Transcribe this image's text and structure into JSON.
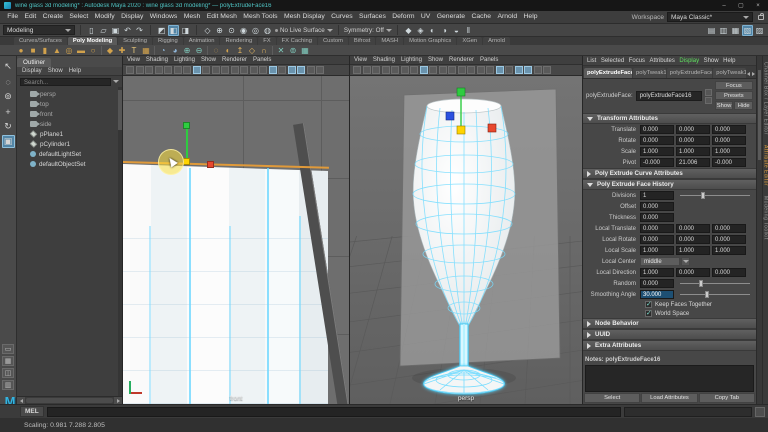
{
  "titlebar": {
    "title": "wine glass 3d modeling* : Autodesk Maya 2020 : wine glass 3d modeling*  —  polyExtrudeFace16",
    "minimize": "–",
    "maximize": "▢",
    "close": "×"
  },
  "menubar": {
    "items": [
      "File",
      "Edit",
      "Create",
      "Select",
      "Modify",
      "Display",
      "Windows",
      "Mesh",
      "Edit Mesh",
      "Mesh Tools",
      "Mesh Display",
      "Curves",
      "Surfaces",
      "Deform",
      "UV",
      "Generate",
      "Cache",
      "Arnold",
      "Help"
    ],
    "workspace_label": "Workspace",
    "workspace_value": "Maya Classic*"
  },
  "toolbar": {
    "mode": "Modeling",
    "file_icons": [
      {
        "name": "new-scene-icon",
        "glyph": "▯"
      },
      {
        "name": "open-scene-icon",
        "glyph": "▱"
      },
      {
        "name": "save-scene-icon",
        "glyph": "▣"
      },
      {
        "name": "undo-icon",
        "glyph": "↶"
      },
      {
        "name": "redo-icon",
        "glyph": "↷"
      }
    ],
    "mask_icons": [
      {
        "name": "select-hierarchy-icon",
        "glyph": "◩"
      },
      {
        "name": "select-object-icon",
        "glyph": "◧",
        "state": "active"
      },
      {
        "name": "select-component-icon",
        "glyph": "◨"
      }
    ],
    "snap_icons": [
      {
        "name": "snap-grid-icon",
        "glyph": "◇"
      },
      {
        "name": "snap-curve-icon",
        "glyph": "⊕"
      },
      {
        "name": "snap-point-icon",
        "glyph": "⊙"
      },
      {
        "name": "snap-projected-center-icon",
        "glyph": "◉"
      },
      {
        "name": "snap-view-plane-icon",
        "glyph": "◎"
      },
      {
        "name": "make-live-icon",
        "glyph": "◍"
      }
    ],
    "no_live_surface": "No Live Surface",
    "symmetry": "Symmetry: Off",
    "render_icons": [
      {
        "name": "render-current-frame-icon",
        "glyph": "◆"
      },
      {
        "name": "ipr-render-icon",
        "glyph": "◈"
      },
      {
        "name": "render-settings-icon",
        "glyph": "◐"
      },
      {
        "name": "hypershade-icon",
        "glyph": "◑"
      },
      {
        "name": "light-editor-icon",
        "glyph": "◒"
      },
      {
        "name": "pause-viewport-icon",
        "glyph": "‖"
      }
    ],
    "right_icons": [
      {
        "name": "modeling-toolkit-toggle-icon",
        "glyph": "▤"
      },
      {
        "name": "character-controls-toggle-icon",
        "glyph": "▥"
      },
      {
        "name": "channel-box-toggle-icon",
        "glyph": "▦"
      },
      {
        "name": "attribute-editor-toggle-icon",
        "glyph": "▧",
        "state": "active"
      },
      {
        "name": "tool-settings-toggle-icon",
        "glyph": "▨"
      }
    ]
  },
  "shelf": {
    "tabs": [
      {
        "label": "Curves/Surfaces"
      },
      {
        "label": "Poly Modeling",
        "state": "active"
      },
      {
        "label": "Sculpting"
      },
      {
        "label": "Rigging"
      },
      {
        "label": "Animation"
      },
      {
        "label": "Rendering"
      },
      {
        "label": "FX"
      },
      {
        "label": "FX Caching"
      },
      {
        "label": "Custom"
      },
      {
        "label": "Bifrost"
      },
      {
        "label": "MASH"
      },
      {
        "label": "Motion Graphics"
      },
      {
        "label": "XGen"
      },
      {
        "label": "Arnold"
      }
    ],
    "icons": [
      {
        "name": "poly-sphere-icon",
        "glyph": "●",
        "color": "#d2a24c"
      },
      {
        "name": "poly-cube-icon",
        "glyph": "■",
        "color": "#d2a24c"
      },
      {
        "name": "poly-cylinder-icon",
        "glyph": "▮",
        "color": "#d2a24c"
      },
      {
        "name": "poly-cone-icon",
        "glyph": "▲",
        "color": "#d2a24c"
      },
      {
        "name": "poly-torus-icon",
        "glyph": "◎",
        "color": "#d2a24c"
      },
      {
        "name": "poly-plane-icon",
        "glyph": "▬",
        "color": "#d2a24c"
      },
      {
        "name": "poly-disc-icon",
        "glyph": "○",
        "color": "#d2a24c"
      },
      {
        "name": "shelf-divider",
        "state": "divider",
        "glyph": ""
      },
      {
        "name": "platonic-solid-icon",
        "glyph": "◆",
        "color": "#d2a24c"
      },
      {
        "name": "sweep-mesh-icon",
        "glyph": "✚",
        "color": "#d2a24c"
      },
      {
        "name": "type-tool-icon",
        "glyph": "T",
        "color": "#e8c87a"
      },
      {
        "name": "svg-tool-icon",
        "glyph": "▦",
        "color": "#d2a24c"
      },
      {
        "name": "shelf-divider",
        "state": "divider",
        "glyph": ""
      },
      {
        "name": "booleans-union-icon",
        "glyph": "◔",
        "color": "#8fb6d9"
      },
      {
        "name": "booleans-difference-icon",
        "glyph": "◕",
        "color": "#8fb6d9"
      },
      {
        "name": "combine-icon",
        "glyph": "⊕",
        "color": "#7fcabc"
      },
      {
        "name": "separate-icon",
        "glyph": "⊖",
        "color": "#7fcabc"
      },
      {
        "name": "shelf-divider",
        "state": "divider",
        "glyph": ""
      },
      {
        "name": "smooth-icon",
        "glyph": "◌",
        "color": "#d2a24c"
      },
      {
        "name": "mirror-icon",
        "glyph": "◐",
        "color": "#d2a24c"
      },
      {
        "name": "extrude-icon",
        "glyph": "↥",
        "color": "#e0b35f"
      },
      {
        "name": "bevel-icon",
        "glyph": "◇",
        "color": "#e0b35f"
      },
      {
        "name": "bridge-icon",
        "glyph": "∩",
        "color": "#e0b35f"
      },
      {
        "name": "shelf-divider",
        "state": "divider",
        "glyph": ""
      },
      {
        "name": "multi-cut-icon",
        "glyph": "✕",
        "color": "#7fcabc"
      },
      {
        "name": "target-weld-icon",
        "glyph": "⊚",
        "color": "#7fcabc"
      },
      {
        "name": "quad-draw-icon",
        "glyph": "▦",
        "color": "#7fcabc"
      }
    ]
  },
  "toolbox": {
    "tools": [
      {
        "name": "select-tool-icon",
        "glyph": "↖"
      },
      {
        "name": "lasso-select-tool-icon",
        "glyph": "◌"
      },
      {
        "name": "paint-select-tool-icon",
        "glyph": "⊚"
      },
      {
        "name": "move-tool-icon",
        "glyph": "+"
      },
      {
        "name": "rotate-tool-icon",
        "glyph": "↻"
      },
      {
        "name": "scale-tool-icon",
        "glyph": "▣",
        "state": "active"
      }
    ],
    "layouts": [
      {
        "name": "layout-single-pane-icon",
        "glyph": "▭"
      },
      {
        "name": "layout-four-pane-icon",
        "glyph": "▦"
      },
      {
        "name": "layout-two-pane-icon",
        "glyph": "◫"
      },
      {
        "name": "layout-outliner-pane-icon",
        "glyph": "▥"
      }
    ]
  },
  "outliner": {
    "tab": "Outliner",
    "menus": [
      "Display",
      "Show",
      "Help"
    ],
    "search_placeholder": "Search...",
    "items": [
      {
        "label": "persp",
        "type": "camera",
        "state": "dim"
      },
      {
        "label": "top",
        "type": "camera",
        "state": "dim"
      },
      {
        "label": "front",
        "type": "camera",
        "state": "dim"
      },
      {
        "label": "side",
        "type": "camera",
        "state": "dim"
      },
      {
        "label": "pPlane1",
        "type": "mesh"
      },
      {
        "label": "pCylinder1",
        "type": "mesh"
      },
      {
        "label": "defaultLightSet",
        "type": "set"
      },
      {
        "label": "defaultObjectSet",
        "type": "set"
      }
    ]
  },
  "viewport_menus": [
    "View",
    "Shading",
    "Lighting",
    "Show",
    "Renderer",
    "Panels"
  ],
  "viewport_left": {
    "camera_label": "front",
    "icons": [
      {
        "name": "vp-select-camera-icon"
      },
      {
        "name": "vp-lock-camera-icon"
      },
      {
        "name": "vp-camera-attrs-icon"
      },
      {
        "name": "vp-bookmark-icon"
      },
      {
        "name": "vp-image-plane-icon"
      },
      {
        "name": "vp-2d-pan-zoom-icon"
      },
      {
        "name": "vp-grease-pencil-icon"
      },
      {
        "name": "vp-grid-icon",
        "state": "active"
      },
      {
        "name": "vp-film-gate-icon"
      },
      {
        "name": "vp-resolution-gate-icon"
      },
      {
        "name": "vp-gate-mask-icon"
      },
      {
        "name": "vp-field-chart-icon"
      },
      {
        "name": "vp-safe-action-icon"
      },
      {
        "name": "vp-safe-title-icon"
      },
      {
        "name": "vp-wireframe-icon"
      },
      {
        "name": "vp-shaded-icon",
        "state": "active"
      },
      {
        "name": "vp-textured-icon"
      },
      {
        "name": "vp-use-all-lights-icon",
        "state": "active"
      },
      {
        "name": "vp-shadows-icon",
        "state": "active"
      },
      {
        "name": "vp-ao-icon"
      },
      {
        "name": "vp-anti-alias-icon"
      }
    ]
  },
  "viewport_right": {
    "camera_label": "persp",
    "icons": [
      {
        "name": "vp-select-camera-icon"
      },
      {
        "name": "vp-lock-camera-icon"
      },
      {
        "name": "vp-camera-attrs-icon"
      },
      {
        "name": "vp-bookmark-icon"
      },
      {
        "name": "vp-image-plane-icon"
      },
      {
        "name": "vp-2d-pan-zoom-icon"
      },
      {
        "name": "vp-grease-pencil-icon"
      },
      {
        "name": "vp-grid-icon",
        "state": "active"
      },
      {
        "name": "vp-film-gate-icon"
      },
      {
        "name": "vp-resolution-gate-icon"
      },
      {
        "name": "vp-gate-mask-icon"
      },
      {
        "name": "vp-field-chart-icon"
      },
      {
        "name": "vp-safe-action-icon"
      },
      {
        "name": "vp-safe-title-icon"
      },
      {
        "name": "vp-wireframe-icon"
      },
      {
        "name": "vp-shaded-icon",
        "state": "active"
      },
      {
        "name": "vp-textured-icon"
      },
      {
        "name": "vp-use-all-lights-icon",
        "state": "active"
      },
      {
        "name": "vp-shadows-icon",
        "state": "active"
      },
      {
        "name": "vp-ao-icon"
      },
      {
        "name": "vp-anti-alias-icon"
      }
    ]
  },
  "attribute_editor": {
    "menus": [
      {
        "label": "List"
      },
      {
        "label": "Selected"
      },
      {
        "label": "Focus"
      },
      {
        "label": "Attributes"
      },
      {
        "label": "Display",
        "state": "accent"
      },
      {
        "label": "Show"
      },
      {
        "label": "Help"
      }
    ],
    "tabs": [
      {
        "label": "polyExtrudeFace16",
        "state": "active"
      },
      {
        "label": "polyTweak15"
      },
      {
        "label": "polyExtrudeFace15"
      },
      {
        "label": "polyTweak14"
      }
    ],
    "node_label": "polyExtrudeFace:",
    "node_value": "polyExtrudeFace16",
    "focus_btn": "Focus",
    "presets_btn": "Presets",
    "show_btn": "Show",
    "hide_btn": "Hide",
    "transform": {
      "title": "Transform Attributes",
      "rows": [
        {
          "label": "Translate",
          "v1": "0.000",
          "v2": "0.000",
          "v3": "0.000"
        },
        {
          "label": "Rotate",
          "v1": "0.000",
          "v2": "0.000",
          "v3": "0.000"
        },
        {
          "label": "Scale",
          "v1": "1.000",
          "v2": "1.000",
          "v3": "1.000"
        },
        {
          "label": "Pivot",
          "v1": "-0.000",
          "v2": "21.006",
          "v3": "-0.000"
        }
      ]
    },
    "curve_section_title": "Poly Extrude Curve Attributes",
    "history": {
      "title": "Poly Extrude Face History",
      "divisions_label": "Divisions",
      "divisions_value": "1",
      "offset_label": "Offset",
      "offset_value": "0.000",
      "thickness_label": "Thickness",
      "thickness_value": "0.000",
      "local_translate_label": "Local Translate",
      "lt1": "0.000",
      "lt2": "0.000",
      "lt3": "0.000",
      "local_rotate_label": "Local Rotate",
      "lr1": "0.000",
      "lr2": "0.000",
      "lr3": "0.000",
      "local_scale_label": "Local Scale",
      "ls1": "1.000",
      "ls2": "1.000",
      "ls3": "1.000",
      "local_center_label": "Local Center",
      "local_center_value": "middle",
      "local_direction_label": "Local Direction",
      "ld1": "1.000",
      "ld2": "0.000",
      "ld3": "0.000",
      "random_label": "Random",
      "random_value": "0.000",
      "smoothing_label": "Smoothing Angle",
      "smoothing_value": "30.000",
      "check1": "Keep Faces Together",
      "check2": "World Space",
      "checkmark": "✓"
    },
    "collapsed_sections": [
      "Node Behavior",
      "UUID",
      "Extra Attributes"
    ],
    "notes_label": "Notes: polyExtrudeFace16",
    "footer_buttons": [
      "Select",
      "Load Attributes",
      "Copy Tab"
    ],
    "side_tabs": [
      {
        "label": "Channel Box / Layer Editor"
      },
      {
        "label": "Attribute Editor",
        "state": "active"
      },
      {
        "label": "Modeling Toolkit"
      }
    ]
  },
  "mel": {
    "label": "MEL"
  },
  "helpline": {
    "text": "Scaling: 0.981  7.288  2.805"
  },
  "maya_logo": "M"
}
